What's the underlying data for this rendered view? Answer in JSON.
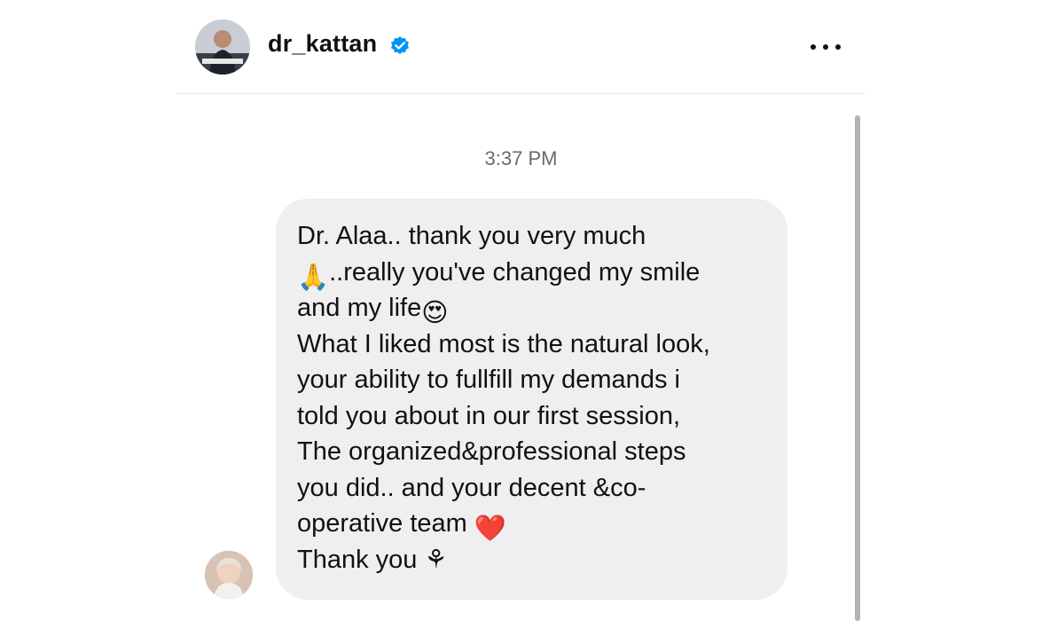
{
  "header": {
    "username": "dr_kattan",
    "verified": true,
    "avatar_icon": "profile-photo-dr-kattan",
    "more_icon": "more-horizontal-icon"
  },
  "conversation": {
    "timestamp": "3:37 PM",
    "message": {
      "lines": [
        "Dr. Alaa.. thank you very much",
        "..really you've changed my smile",
        "and my life",
        "What I liked most is the natural look,",
        "your ability to fullfill my demands i",
        "told you about in our first session,",
        "The organized&professional steps",
        "you did.. and your decent &co-",
        "operative team ",
        " Thank you "
      ],
      "emojis": {
        "folded_hands": "🙏",
        "heart_eyes": "😍",
        "red_heart": "❤️",
        "flower": "⚘"
      }
    },
    "sender_avatar_icon": "profile-photo-sender"
  },
  "colors": {
    "verified_blue": "#0095f6",
    "bubble_bg": "#efefef",
    "timestamp_gray": "#6b6b6b"
  }
}
